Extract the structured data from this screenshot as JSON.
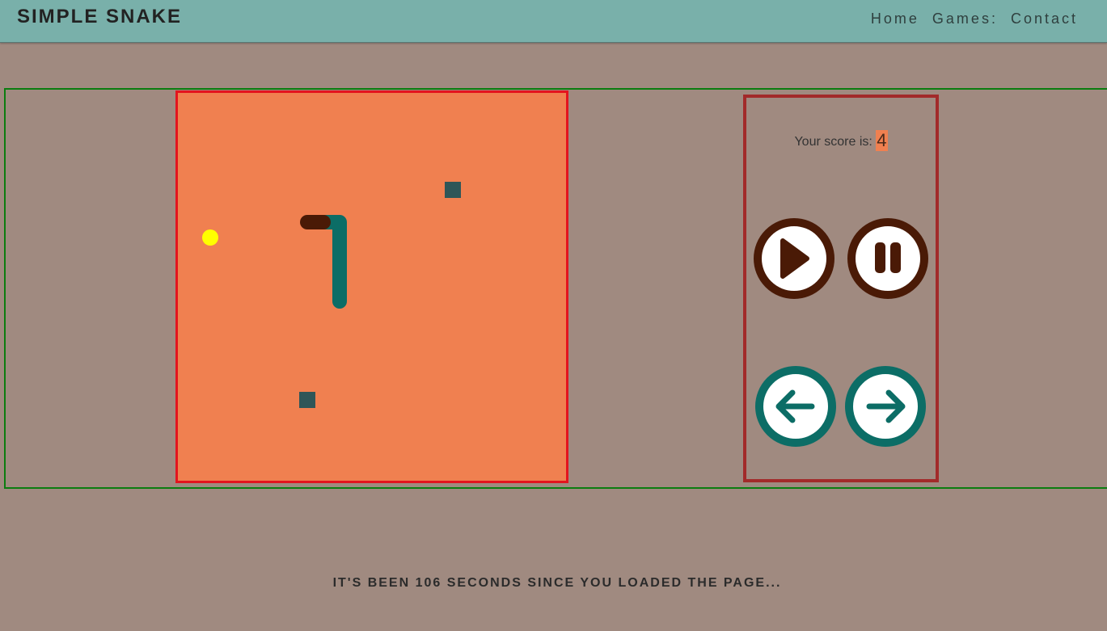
{
  "header": {
    "title": "SIMPLE SNAKE",
    "nav": [
      "Home",
      "Games:",
      "Contact"
    ]
  },
  "panel": {
    "score_label": "Your score is:",
    "score_value": "4"
  },
  "controls": {
    "play": "play-icon",
    "pause": "pause-icon",
    "left": "arrow-left-icon",
    "right": "arrow-right-icon"
  },
  "footer": {
    "message": "IT'S BEEN 106 SECONDS SINCE YOU LOADED THE PAGE..."
  },
  "colors": {
    "board": "#f08050",
    "board_border": "#e3141e",
    "snake_body": "#0c6d66",
    "snake_head": "#4a1a06",
    "food": "#ffff00",
    "obstacle": "#2f5658",
    "panel_border": "#a22a2a",
    "play_pause_ring": "#4a1a06",
    "arrow_ring": "#0c6d66"
  }
}
